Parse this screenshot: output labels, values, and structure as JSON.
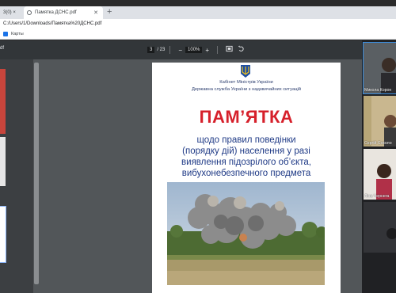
{
  "browser": {
    "tabs": [
      {
        "label": "3(0) ×"
      },
      {
        "label": "Памятка ДСНС.pdf"
      }
    ],
    "new_tab": "+",
    "url": "C:/Users/1/Downloads/Памятка%20ДСНС.pdf",
    "bookmark": "Карты"
  },
  "pdf_toolbar": {
    "left_fragment": "df",
    "page_current": "3",
    "page_sep": "/ 23",
    "zoom_out": "−",
    "zoom_value": "100%",
    "zoom_in": "+"
  },
  "document": {
    "org_line1": "Кабінет Міністрів України",
    "org_line2": "Державна служба України з надзвичайних ситуацій",
    "title": "ПАМ’ЯТКА",
    "subtitle_lines": [
      "щодо правил поведінки",
      "(порядку дій) населення у разі",
      "виявлення підозрілого об’єкта,",
      "вибухонебезпечного предмета"
    ]
  },
  "participants": [
    {
      "name": "Микола Корон"
    },
    {
      "name": "Сергій Соколо"
    },
    {
      "name": "Ліна Чернега"
    }
  ],
  "colors": {
    "title_red": "#d6202b",
    "text_blue": "#1f3a86",
    "toolbar_dark": "#323639",
    "viewer_gray": "#525659"
  }
}
